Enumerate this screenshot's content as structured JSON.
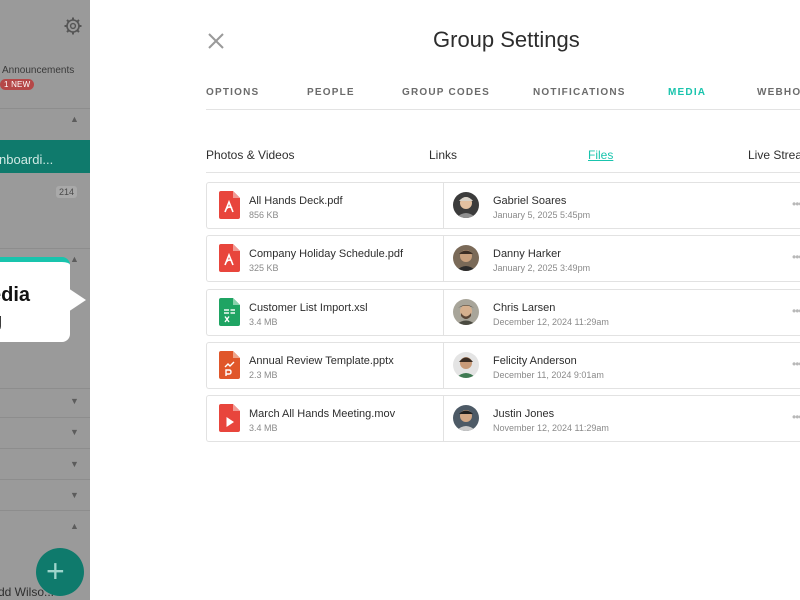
{
  "sidebar": {
    "group_name": "Announcements",
    "new_badge": "1 NEW",
    "active_item": "nboardi...",
    "count": "214",
    "user": "dd Wilso..."
  },
  "tooltip": {
    "text": "edia\ng"
  },
  "header": {
    "title": "Group Settings"
  },
  "tabs": [
    "OPTIONS",
    "PEOPLE",
    "GROUP CODES",
    "NOTIFICATIONS",
    "MEDIA",
    "WEBHOO"
  ],
  "active_tab": "MEDIA",
  "subtabs": [
    "Photos & Videos",
    "Links",
    "Files",
    "Live Strea"
  ],
  "active_subtab": "Files",
  "files": [
    {
      "name": "All Hands Deck.pdf",
      "size": "856 KB",
      "type": "pdf",
      "user": "Gabriel Soares",
      "date": "January 5, 2025 5:45pm"
    },
    {
      "name": "Company Holiday Schedule.pdf",
      "size": "325 KB",
      "type": "pdf",
      "user": "Danny Harker",
      "date": "January 2, 2025 3:49pm"
    },
    {
      "name": "Customer List Import.xsl",
      "size": "3.4 MB",
      "type": "xls",
      "user": "Chris Larsen",
      "date": "December 12, 2024 11:29am"
    },
    {
      "name": "Annual Review Template.pptx",
      "size": "2.3 MB",
      "type": "ppt",
      "user": "Felicity Anderson",
      "date": "December 11, 2024 9:01am"
    },
    {
      "name": "March All Hands Meeting.mov",
      "size": "3.4 MB",
      "type": "mov",
      "user": "Justin Jones",
      "date": "November 12, 2024 11:29am"
    }
  ],
  "colors": {
    "accent": "#19c4ad",
    "pdf": "#e8453c",
    "xls": "#1fa463",
    "ppt": "#e0562a",
    "mov": "#e8453c",
    "sidebar_active": "#0f7a6c"
  }
}
